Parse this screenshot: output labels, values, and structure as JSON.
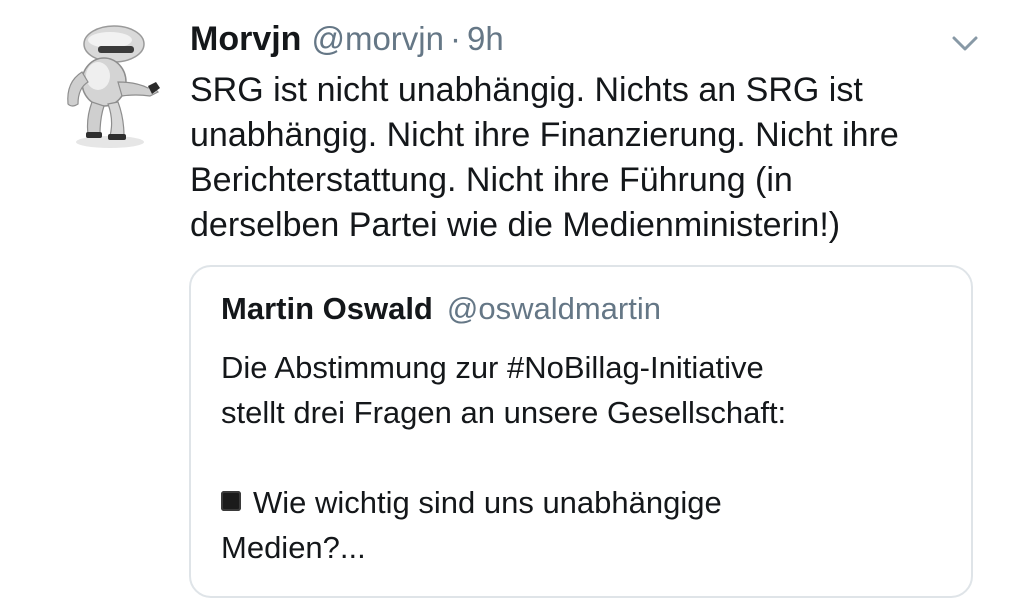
{
  "tweet": {
    "author_name": "Morvjn",
    "author_handle": "@morvjn",
    "separator": "·",
    "time": "9h",
    "body_lines": [
      "SRG ist nicht unabhängig. Nichts an SRG ist",
      "unabhängig. Nicht ihre Finanzierung. Nicht ihre",
      "Berichterstattung. Nicht ihre Führung (in",
      "derselben Partei wie die Medienministerin!)"
    ],
    "avatar_icon": "robot-avatar-icon",
    "menu_icon": "chevron-down-icon"
  },
  "quoted_tweet": {
    "author_name": "Martin Oswald",
    "author_handle": "@oswaldmartin",
    "body_lines": [
      "Die Abstimmung zur #NoBillag-Initiative",
      "stellt drei Fragen an unsere Gesellschaft:",
      "",
      "Wie wichtig sind uns unabhängige",
      "Medien?..."
    ],
    "bullet_icon": "black-square-icon"
  }
}
